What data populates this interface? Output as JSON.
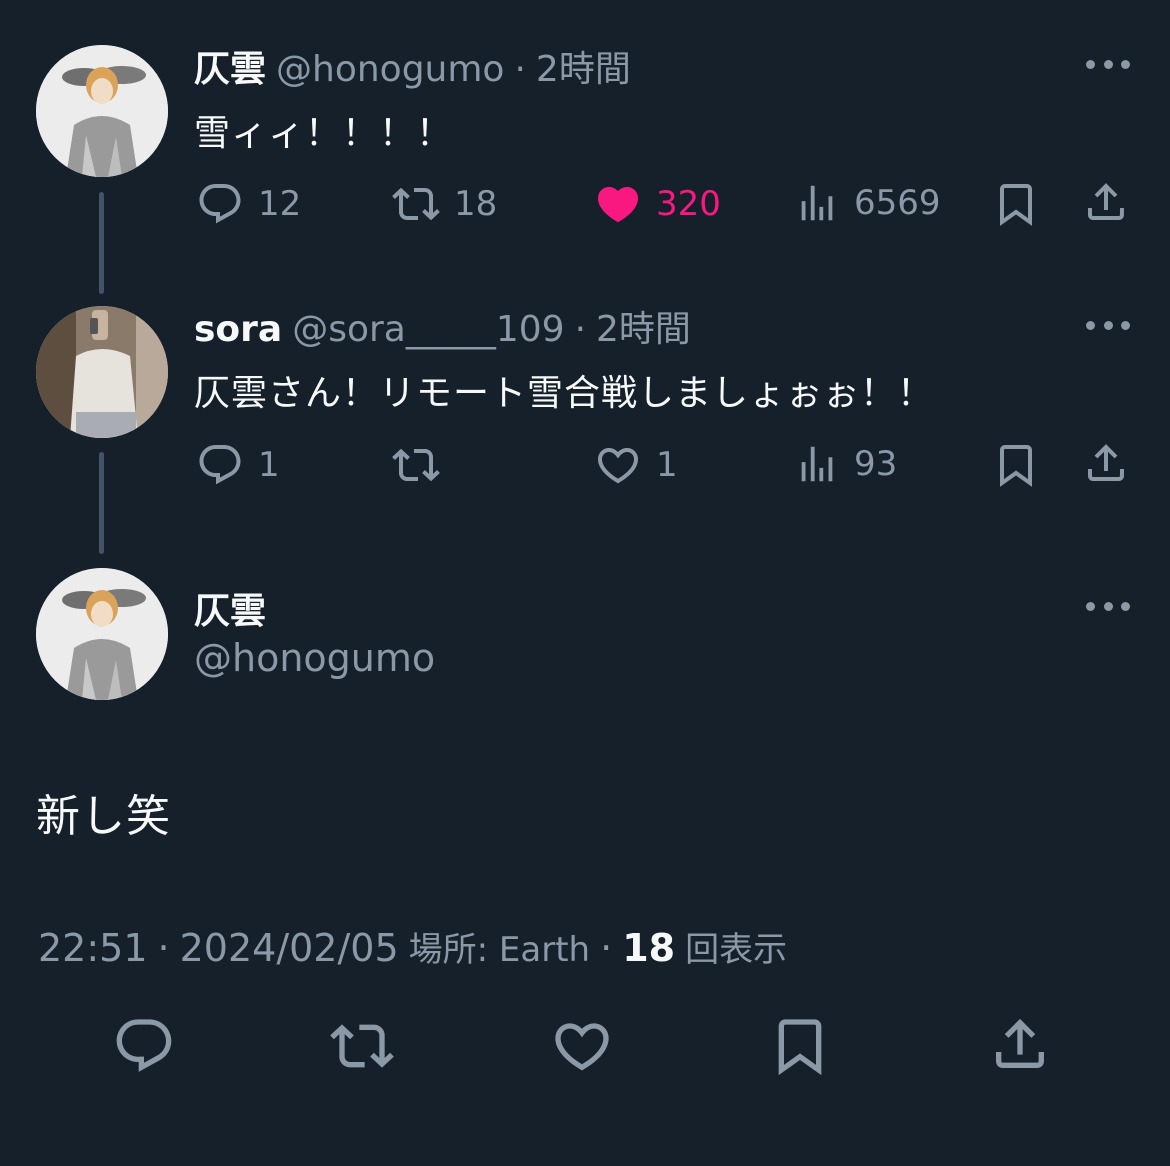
{
  "tweets": [
    {
      "display_name": "仄雲",
      "handle": "@honogumo",
      "time": "2時間",
      "text": "雪ィィ！！！！",
      "replies": "12",
      "retweets": "18",
      "likes": "320",
      "views": "6569",
      "liked": true
    },
    {
      "display_name": "sora",
      "handle": "@sora_____109",
      "time": "2時間",
      "text": "仄雲さん！リモート雪合戦しましょぉぉ！！",
      "replies": "1",
      "retweets": "",
      "likes": "1",
      "views": "93",
      "liked": false
    }
  ],
  "main": {
    "display_name": "仄雲",
    "handle": "@honogumo",
    "text": "新し笑",
    "time": "22:51",
    "date": "2024/02/05",
    "location": "場所: Earth",
    "views_count": "18",
    "views_label": "回表示"
  },
  "separator": "·",
  "colors": {
    "background": "#15202b",
    "text_primary": "#f7f9f9",
    "text_secondary": "#8b98a5",
    "like_active": "#f91880",
    "thread_line": "#42536a"
  },
  "icons": [
    "reply-icon",
    "retweet-icon",
    "like-icon",
    "views-icon",
    "bookmark-icon",
    "share-icon",
    "more-icon"
  ]
}
